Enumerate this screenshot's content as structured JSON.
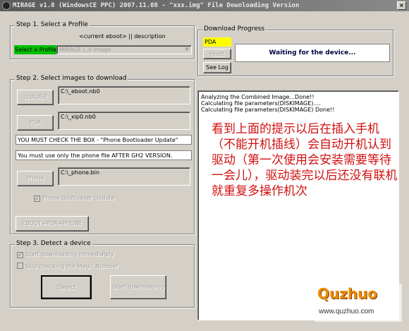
{
  "window": {
    "title": "MIRAGE v1.8 (WindowsCE PPC) 2007.11.08 - \"xxx.img\" File Downloading Version",
    "close_glyph": "×"
  },
  "step1": {
    "label": "Step 1. Select a Profile",
    "profile_header": "<current eboot> || description",
    "select_button": "Select a Profile",
    "profile_value": "MIRAGE L.V image"
  },
  "progress": {
    "label": "Download Progress",
    "device_field": "PDA",
    "reset_button": "reset",
    "status": "Waiting for the device...",
    "seelog_button": "See Log"
  },
  "step2": {
    "label": "Step 2. Select images to download",
    "loader_button": "LOADER",
    "loader_path": "C:\\_eboot.nb0",
    "pda_button": "PDA",
    "pda_path": "C:\\_xip0.nb0",
    "msg1": "YOU MUST CHECK THE BOX  -  \"Phone Bootloader Update\"",
    "msg2": "You must use only the phone file AFTER  GH2 VERSION.",
    "phone_button": "Phone",
    "phone_path": "C:\\_phone.bin",
    "bootloader_check": "Phone Bootloader Update",
    "eboot_button": "EBOOT+PDA+PHONE"
  },
  "step3": {
    "label": "Step 3. Detect a device",
    "check_start": "Start downloading immediately",
    "check_skip": "Skip checking the Magic Number",
    "detect_button": "Detect",
    "start_button": "Start downloading"
  },
  "log": {
    "lines": [
      "Analyzing the Combined Image...Done!!",
      "Calculating file parameters(DISKIMAGE)....",
      "Calculating file parameters(DISKIMAGE) Done!!"
    ]
  },
  "note": {
    "text": "看到上面的提示以后在插入手机（不能开机插线）会自动开机认到驱动（第一次使用会安装需要等待一会儿），驱动装完以后还没有联机就重复多操作机次"
  },
  "watermark": {
    "logo": "Quzhuo",
    "url": "www.quzhuo.com"
  },
  "colors": {
    "select_button_bg": "#00c000",
    "device_field_bg": "#ffff00",
    "note_text": "#d01010"
  }
}
